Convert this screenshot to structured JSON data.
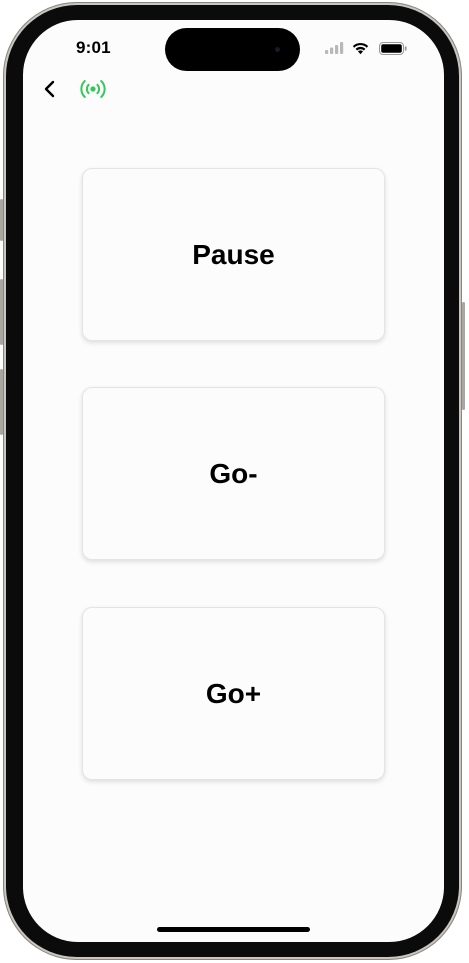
{
  "status_bar": {
    "time": "9:01",
    "icons": [
      "cellular-signal-icon",
      "wifi-icon",
      "battery-icon"
    ]
  },
  "nav": {
    "back_icon": "chevron-left-icon",
    "broadcast_icon": "broadcast-icon",
    "broadcast_color": "#34c759"
  },
  "buttons": {
    "pause_label": "Pause",
    "go_minus_label": "Go-",
    "go_plus_label": "Go+"
  }
}
